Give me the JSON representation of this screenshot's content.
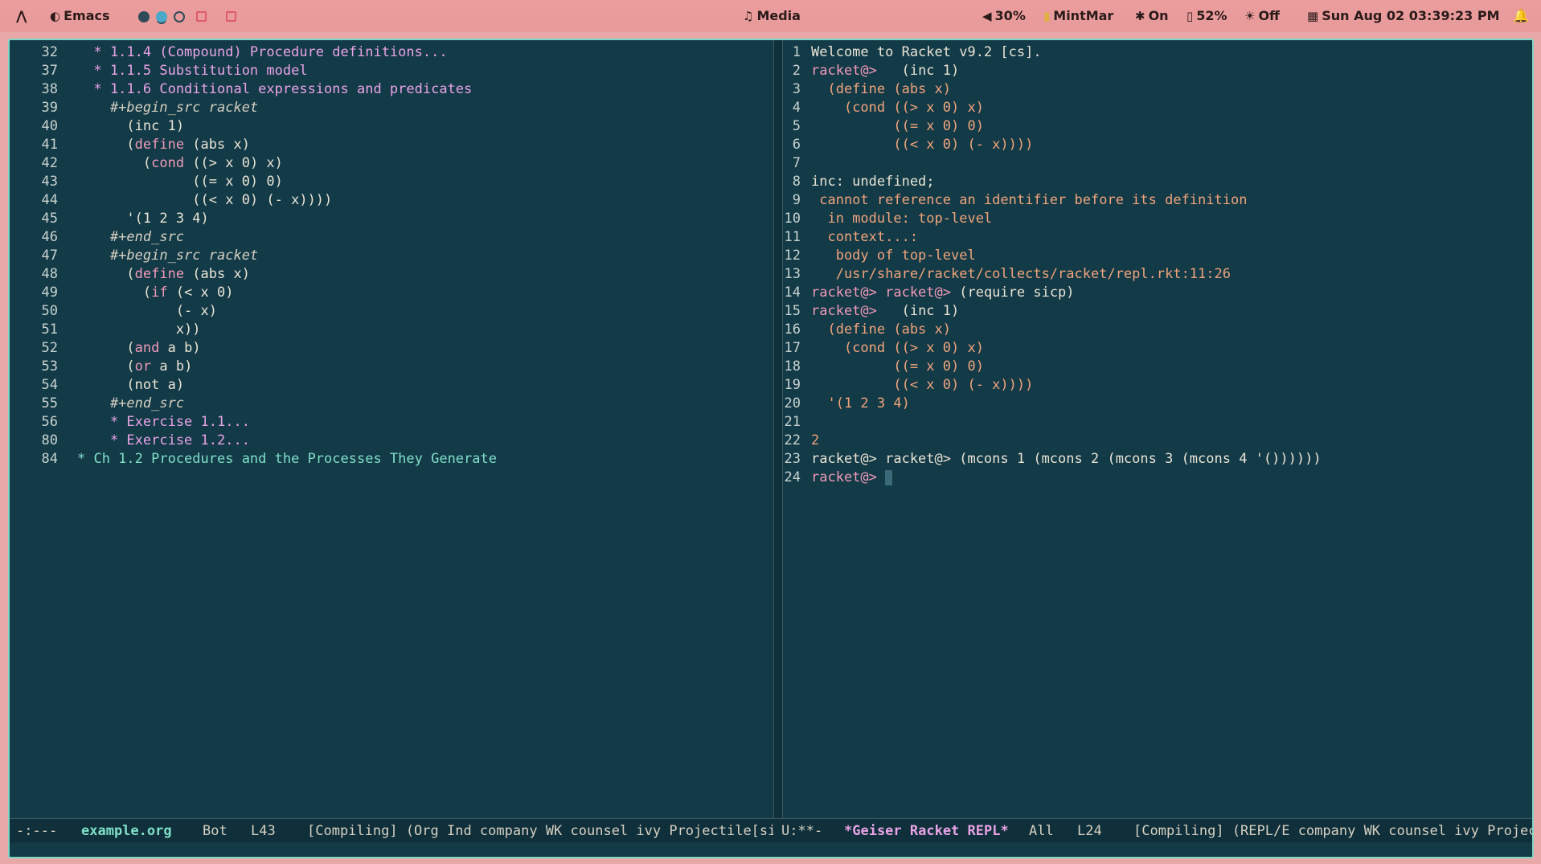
{
  "topbar": {
    "launcher": "⋀",
    "app_name": "Emacs",
    "media": "Media",
    "volume": "30%",
    "user": "MintMar",
    "bluetooth": "On",
    "battery": "52%",
    "brightness": "Off",
    "datetime": "Sun Aug 02 03:39:23 PM"
  },
  "left_pane": {
    "lines": [
      {
        "n": "32",
        "parts": [
          {
            "c": "h",
            "t": "  * 1.1.4 (Compound) Procedure definitions..."
          }
        ]
      },
      {
        "n": "37",
        "parts": [
          {
            "c": "h",
            "t": "  * 1.1.5 Substitution model"
          }
        ]
      },
      {
        "n": "38",
        "parts": [
          {
            "c": "h",
            "t": "  * 1.1.6 Conditional expressions and predicates"
          }
        ]
      },
      {
        "n": "39",
        "parts": [
          {
            "c": "meta",
            "t": "    #+begin_src racket"
          }
        ]
      },
      {
        "n": "40",
        "parts": [
          {
            "c": "txt",
            "t": "      (inc 1)"
          }
        ]
      },
      {
        "n": "41",
        "parts": [
          {
            "c": "txt",
            "t": "      ("
          },
          {
            "c": "kw",
            "t": "define"
          },
          {
            "c": "txt",
            "t": " (abs x)"
          }
        ]
      },
      {
        "n": "42",
        "parts": [
          {
            "c": "txt",
            "t": "        ("
          },
          {
            "c": "kw",
            "t": "cond"
          },
          {
            "c": "txt",
            "t": " ((> x 0) x)"
          }
        ]
      },
      {
        "n": "43",
        "parts": [
          {
            "c": "txt",
            "t": "              ((= x 0) 0)"
          }
        ]
      },
      {
        "n": "44",
        "parts": [
          {
            "c": "txt",
            "t": "              ((< x 0) (- x))))"
          }
        ]
      },
      {
        "n": "45",
        "parts": [
          {
            "c": "txt",
            "t": "      '(1 2 3 4)"
          }
        ]
      },
      {
        "n": "46",
        "parts": [
          {
            "c": "meta",
            "t": "    #+end_src"
          }
        ]
      },
      {
        "n": "47",
        "parts": [
          {
            "c": "meta",
            "t": "    #+begin_src racket"
          }
        ]
      },
      {
        "n": "48",
        "parts": [
          {
            "c": "txt",
            "t": "      ("
          },
          {
            "c": "kw",
            "t": "define"
          },
          {
            "c": "txt",
            "t": " (abs x)"
          }
        ]
      },
      {
        "n": "49",
        "parts": [
          {
            "c": "txt",
            "t": "        ("
          },
          {
            "c": "kw",
            "t": "if"
          },
          {
            "c": "txt",
            "t": " (< x 0)"
          }
        ]
      },
      {
        "n": "50",
        "parts": [
          {
            "c": "txt",
            "t": "            (- x)"
          }
        ]
      },
      {
        "n": "51",
        "parts": [
          {
            "c": "txt",
            "t": "            x))"
          }
        ]
      },
      {
        "n": "52",
        "parts": [
          {
            "c": "txt",
            "t": "      ("
          },
          {
            "c": "kw",
            "t": "and"
          },
          {
            "c": "txt",
            "t": " a b)"
          }
        ]
      },
      {
        "n": "53",
        "parts": [
          {
            "c": "txt",
            "t": "      ("
          },
          {
            "c": "kw",
            "t": "or"
          },
          {
            "c": "txt",
            "t": " a b)"
          }
        ]
      },
      {
        "n": "54",
        "parts": [
          {
            "c": "txt",
            "t": "      (not a)"
          }
        ]
      },
      {
        "n": "55",
        "parts": [
          {
            "c": "meta",
            "t": "    #+end_src"
          }
        ]
      },
      {
        "n": "56",
        "parts": [
          {
            "c": "ex",
            "t": "    * Exercise 1.1..."
          }
        ]
      },
      {
        "n": "80",
        "parts": [
          {
            "c": "ex",
            "t": "    * Exercise 1.2..."
          }
        ]
      },
      {
        "n": "84",
        "parts": [
          {
            "c": "ch",
            "t": "* Ch 1.2 Procedures and the Processes They Generate"
          }
        ]
      }
    ]
  },
  "right_pane": {
    "lines": [
      {
        "n": "1",
        "parts": [
          {
            "c": "txt",
            "t": "Welcome to Racket v9.2 [cs]."
          }
        ]
      },
      {
        "n": "2",
        "parts": [
          {
            "c": "prompt",
            "t": "racket@>"
          },
          {
            "c": "txt",
            "t": "   (inc 1)"
          }
        ]
      },
      {
        "n": "3",
        "parts": [
          {
            "c": "err",
            "t": "  (define (abs x)"
          }
        ]
      },
      {
        "n": "4",
        "parts": [
          {
            "c": "err",
            "t": "    (cond ((> x 0) x)"
          }
        ]
      },
      {
        "n": "5",
        "parts": [
          {
            "c": "err",
            "t": "          ((= x 0) 0)"
          }
        ]
      },
      {
        "n": "6",
        "parts": [
          {
            "c": "err",
            "t": "          ((< x 0) (- x))))"
          }
        ]
      },
      {
        "n": "7",
        "parts": [
          {
            "c": "txt",
            "t": ""
          }
        ]
      },
      {
        "n": "8",
        "parts": [
          {
            "c": "txt",
            "t": "inc: undefined;"
          }
        ]
      },
      {
        "n": "9",
        "parts": [
          {
            "c": "err",
            "t": " cannot reference an identifier before its definition"
          }
        ]
      },
      {
        "n": "10",
        "parts": [
          {
            "c": "err",
            "t": "  in module: top-level"
          }
        ]
      },
      {
        "n": "11",
        "parts": [
          {
            "c": "err",
            "t": "  context...:"
          }
        ]
      },
      {
        "n": "12",
        "parts": [
          {
            "c": "err",
            "t": "   body of top-level"
          }
        ]
      },
      {
        "n": "13",
        "parts": [
          {
            "c": "err",
            "t": "   /usr/share/racket/collects/racket/repl.rkt:11:26"
          }
        ]
      },
      {
        "n": "14",
        "parts": [
          {
            "c": "prompt",
            "t": "racket@> racket@>"
          },
          {
            "c": "txt",
            "t": " (require sicp)"
          }
        ]
      },
      {
        "n": "15",
        "parts": [
          {
            "c": "prompt",
            "t": "racket@>"
          },
          {
            "c": "txt",
            "t": "   (inc 1)"
          }
        ]
      },
      {
        "n": "16",
        "parts": [
          {
            "c": "err",
            "t": "  (define (abs x)"
          }
        ]
      },
      {
        "n": "17",
        "parts": [
          {
            "c": "err",
            "t": "    (cond ((> x 0) x)"
          }
        ]
      },
      {
        "n": "18",
        "parts": [
          {
            "c": "err",
            "t": "          ((= x 0) 0)"
          }
        ]
      },
      {
        "n": "19",
        "parts": [
          {
            "c": "err",
            "t": "          ((< x 0) (- x))))"
          }
        ]
      },
      {
        "n": "20",
        "parts": [
          {
            "c": "err",
            "t": "  '(1 2 3 4)"
          }
        ]
      },
      {
        "n": "21",
        "parts": [
          {
            "c": "txt",
            "t": ""
          }
        ]
      },
      {
        "n": "22",
        "parts": [
          {
            "c": "err",
            "t": "2"
          }
        ]
      },
      {
        "n": "23",
        "parts": [
          {
            "c": "txt",
            "t": "racket@> racket@> (mcons 1 (mcons 2 (mcons 3 (mcons 4 '())))))"
          }
        ]
      },
      {
        "n": "24",
        "parts": [
          {
            "c": "prompt",
            "t": "racket@>"
          },
          {
            "c": "txt",
            "t": " "
          }
        ],
        "cursor": true
      }
    ]
  },
  "modeline": {
    "left_state": "-:---",
    "left_buffer": "example.org",
    "left_pos": "Bot",
    "left_line": "L43",
    "left_modes": "[Compiling] (Org Ind company WK counsel ivy Projectile[sicp",
    "right_state": "U:**-",
    "right_buffer": "*Geiser Racket REPL*",
    "right_pos": "All",
    "right_line": "L24",
    "right_modes": "[Compiling] (REPL/E company WK counsel ivy Projectile"
  },
  "colors": {
    "bg": "#133a47",
    "heading": "#e9a3e6",
    "keyword": "#f09ab8",
    "output": "#f0a47c",
    "chapter": "#7fe0c8",
    "topbar": "#ec9d9d"
  }
}
